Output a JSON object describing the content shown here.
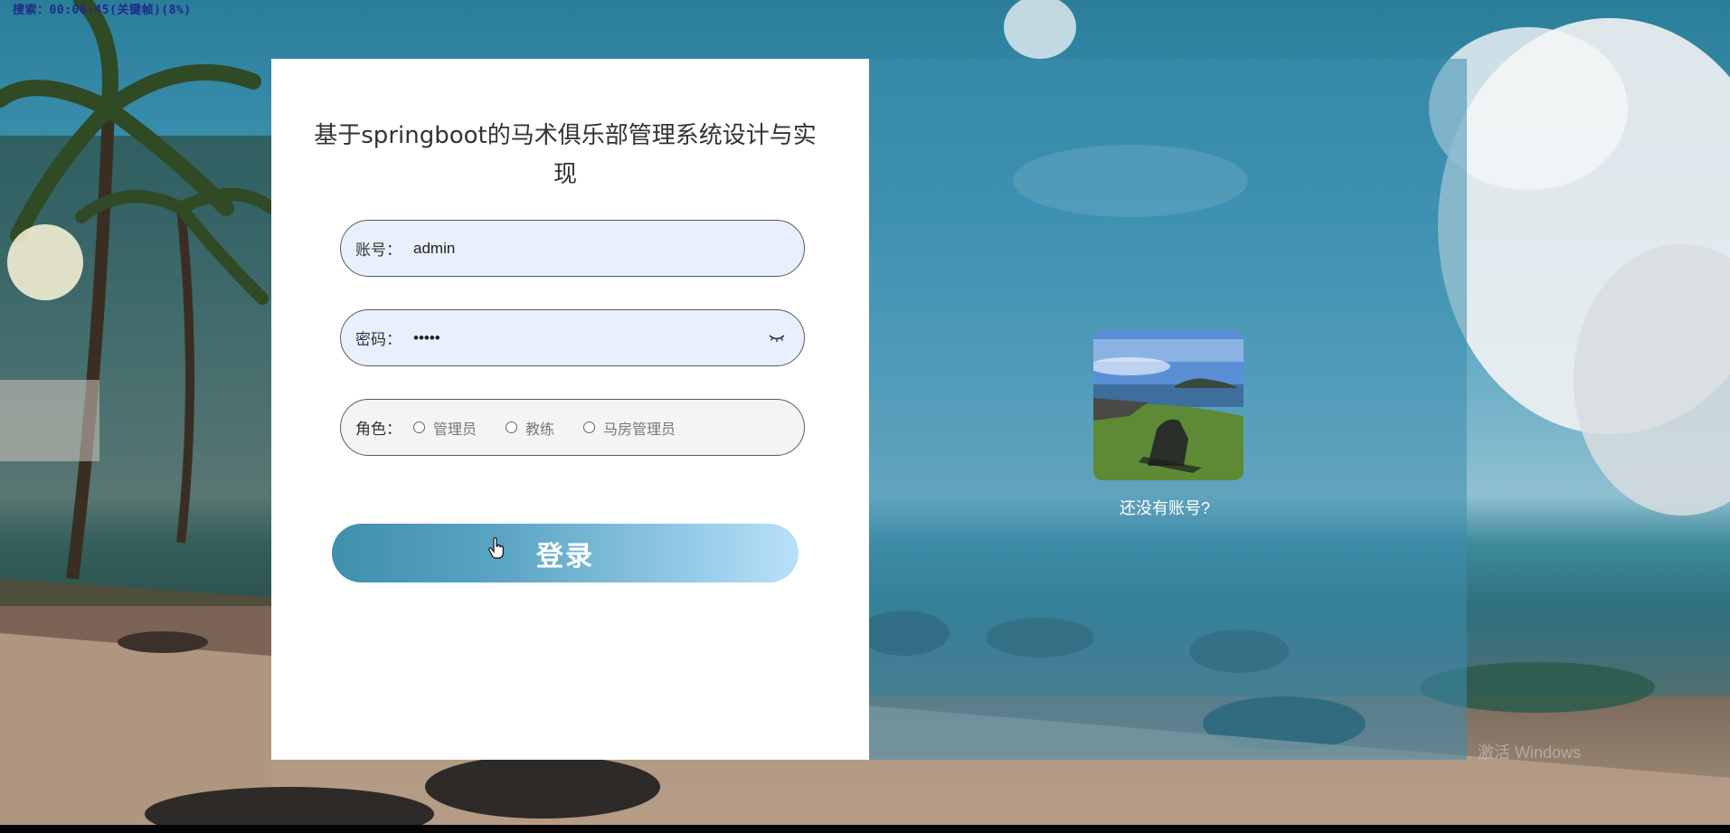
{
  "recorder": {
    "overlay_text": "搜索：00:00:45(关键帧)(8%)"
  },
  "login": {
    "title": "基于springboot的马术俱乐部管理系统设计与实现",
    "account_label": "账号：",
    "account_value": "admin",
    "password_label": "密码：",
    "password_value": "•••••",
    "role_label": "角色：",
    "role_options": [
      {
        "label": "管理员"
      },
      {
        "label": "教练"
      },
      {
        "label": "马房管理员"
      }
    ],
    "submit_label": "登录"
  },
  "right_panel": {
    "register_prompt": "还没有账号?"
  },
  "os": {
    "activation_watermark": "激活 Windows"
  },
  "colors": {
    "button_gradient_start": "#3f8fad",
    "button_gradient_end": "#b9e1f9",
    "input_fill": "#e8f0fe",
    "panel_overlay": "#3c8caf"
  }
}
